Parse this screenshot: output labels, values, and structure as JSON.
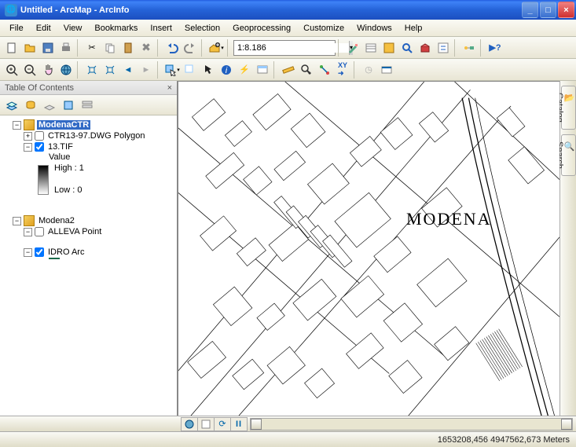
{
  "window": {
    "title": "Untitled - ArcMap - ArcInfo"
  },
  "menu": {
    "items": [
      "File",
      "Edit",
      "View",
      "Bookmarks",
      "Insert",
      "Selection",
      "Geoprocessing",
      "Customize",
      "Windows",
      "Help"
    ]
  },
  "toolbar1": {
    "scale_value": "1:8.186"
  },
  "toc": {
    "title": "Table Of Contents",
    "dataframes": [
      {
        "name": "ModenaCTR",
        "selected": true,
        "layers": [
          {
            "name": "CTR13-97.DWG Polygon",
            "checked": false,
            "expanded": false,
            "type": "polygon"
          },
          {
            "name": "13.TIF",
            "checked": true,
            "expanded": true,
            "type": "raster",
            "legend": {
              "label": "Value",
              "high": "High : 1",
              "low": "Low : 0"
            }
          }
        ]
      },
      {
        "name": "Modena2",
        "selected": false,
        "layers": [
          {
            "name": "ALLEVA Point",
            "checked": false,
            "expanded": false,
            "type": "point"
          },
          {
            "name": "IDRO Arc",
            "checked": true,
            "expanded": true,
            "type": "line"
          }
        ]
      }
    ]
  },
  "map": {
    "label": "MODENA"
  },
  "side_tabs": {
    "catalog": "Catalog",
    "search": "Search"
  },
  "status": {
    "coords": "1653208,456  4947562,673 Meters"
  }
}
